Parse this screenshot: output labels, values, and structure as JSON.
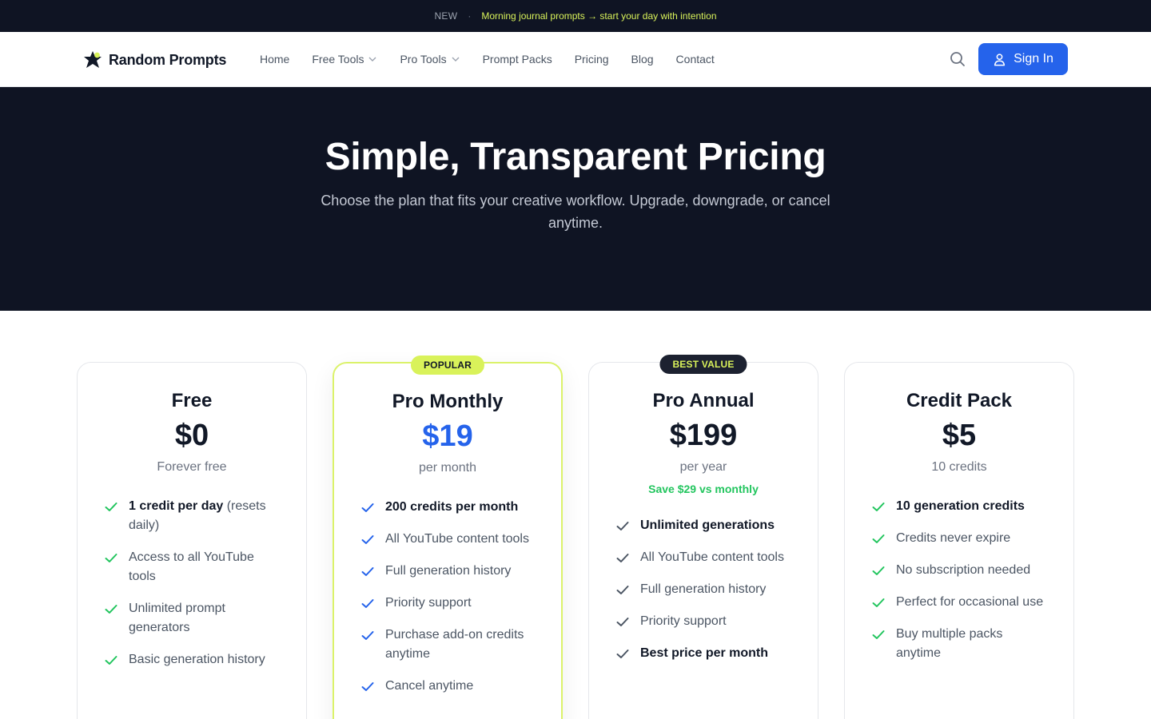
{
  "announcement": {
    "tag": "NEW",
    "separator": "·",
    "message": "Morning journal prompts → start your day with intention"
  },
  "nav": {
    "brand": "Random Prompts",
    "items": [
      "Home",
      "Free Tools",
      "Pro Tools",
      "Prompt Packs",
      "Pricing",
      "Blog",
      "Contact"
    ],
    "dropdown_items": [
      "Free Tools",
      "Pro Tools"
    ],
    "signin_label": "Sign In",
    "icons": {
      "search": "search-icon",
      "user": "user-icon",
      "chevron": "chevron-down-icon"
    }
  },
  "hero": {
    "title": "Simple, Transparent Pricing",
    "subtitle": "Choose the plan that fits your creative workflow. Upgrade, downgrade, or cancel anytime."
  },
  "colors": {
    "dark_bg": "#0f1423",
    "accent_lime": "#d9f25a",
    "primary_blue": "#2563eb",
    "check_green": "#22c55e",
    "check_blue": "#2563eb",
    "check_gray": "#4b5563"
  },
  "plans": [
    {
      "name": "Free",
      "price": "$0",
      "period": "Forever free",
      "badge": null,
      "features": [
        {
          "strong": "1 credit per day",
          "text": " (resets daily)"
        },
        {
          "strong": "",
          "text": "Access to all YouTube tools"
        },
        {
          "strong": "",
          "text": "Unlimited prompt generators"
        },
        {
          "strong": "",
          "text": "Basic generation history"
        }
      ]
    },
    {
      "name": "Pro Monthly",
      "price": "$19",
      "period": "per month",
      "badge": "POPULAR",
      "features": [
        {
          "strong": "200 credits per month",
          "text": ""
        },
        {
          "strong": "",
          "text": "All YouTube content tools"
        },
        {
          "strong": "",
          "text": "Full generation history"
        },
        {
          "strong": "",
          "text": "Priority support"
        },
        {
          "strong": "",
          "text": "Purchase add-on credits anytime"
        },
        {
          "strong": "",
          "text": "Cancel anytime"
        }
      ]
    },
    {
      "name": "Pro Annual",
      "price": "$199",
      "period": "per year",
      "savings": "Save $29 vs monthly",
      "badge": "BEST VALUE",
      "features": [
        {
          "strong": "Unlimited generations",
          "text": ""
        },
        {
          "strong": "",
          "text": "All YouTube content tools"
        },
        {
          "strong": "",
          "text": "Full generation history"
        },
        {
          "strong": "",
          "text": "Priority support"
        },
        {
          "strong": "Best price per month",
          "text": ""
        }
      ]
    },
    {
      "name": "Credit Pack",
      "price": "$5",
      "period": "10 credits",
      "badge": null,
      "features": [
        {
          "strong": "10 generation credits",
          "text": ""
        },
        {
          "strong": "",
          "text": "Credits never expire"
        },
        {
          "strong": "",
          "text": "No subscription needed"
        },
        {
          "strong": "",
          "text": "Perfect for occasional use"
        },
        {
          "strong": "",
          "text": "Buy multiple packs anytime"
        }
      ]
    }
  ]
}
